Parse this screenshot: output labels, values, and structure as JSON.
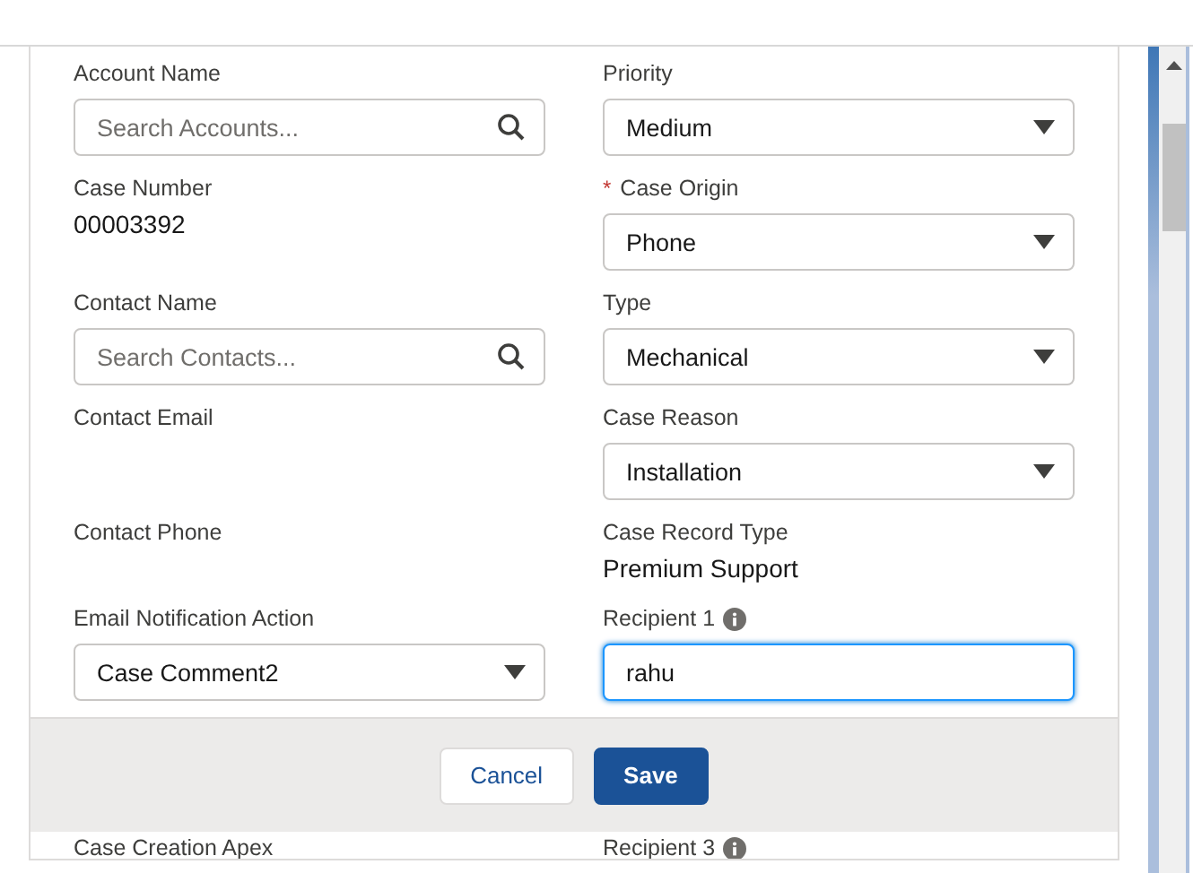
{
  "form": {
    "rows": [
      {
        "left": {
          "kind": "lookup",
          "label": "Account Name",
          "placeholder": "Search Accounts..."
        },
        "right": {
          "kind": "picklist",
          "label": "Priority",
          "value": "Medium"
        }
      },
      {
        "left": {
          "kind": "output",
          "label": "Case Number",
          "value": "00003392"
        },
        "right": {
          "kind": "picklist",
          "label": "Case Origin",
          "required_mark": "*",
          "value": "Phone"
        }
      },
      {
        "left": {
          "kind": "lookup",
          "label": "Contact Name",
          "placeholder": "Search Contacts..."
        },
        "right": {
          "kind": "picklist",
          "label": "Type",
          "value": "Mechanical"
        }
      },
      {
        "left": {
          "kind": "output",
          "label": "Contact Email"
        },
        "right": {
          "kind": "picklist",
          "label": "Case Reason",
          "value": "Installation"
        }
      },
      {
        "left": {
          "kind": "output",
          "label": "Contact Phone"
        },
        "right": {
          "kind": "output",
          "label": "Case Record Type",
          "value": "Premium Support"
        }
      },
      {
        "left": {
          "kind": "picklist",
          "label": "Email Notification Action",
          "value": "Case Comment2"
        },
        "right": {
          "kind": "input",
          "label": "Recipient 1",
          "info": true,
          "focused": true,
          "value": "rahu"
        }
      }
    ],
    "rows_below_footer": [
      {
        "left": {
          "label": "Case Creation Apex"
        },
        "right": {
          "label": "Recipient 3",
          "info": true
        }
      }
    ]
  },
  "footer": {
    "buttons": [
      {
        "label": "Cancel",
        "kind": "neutral"
      },
      {
        "label": "Save",
        "kind": "brand"
      }
    ]
  }
}
